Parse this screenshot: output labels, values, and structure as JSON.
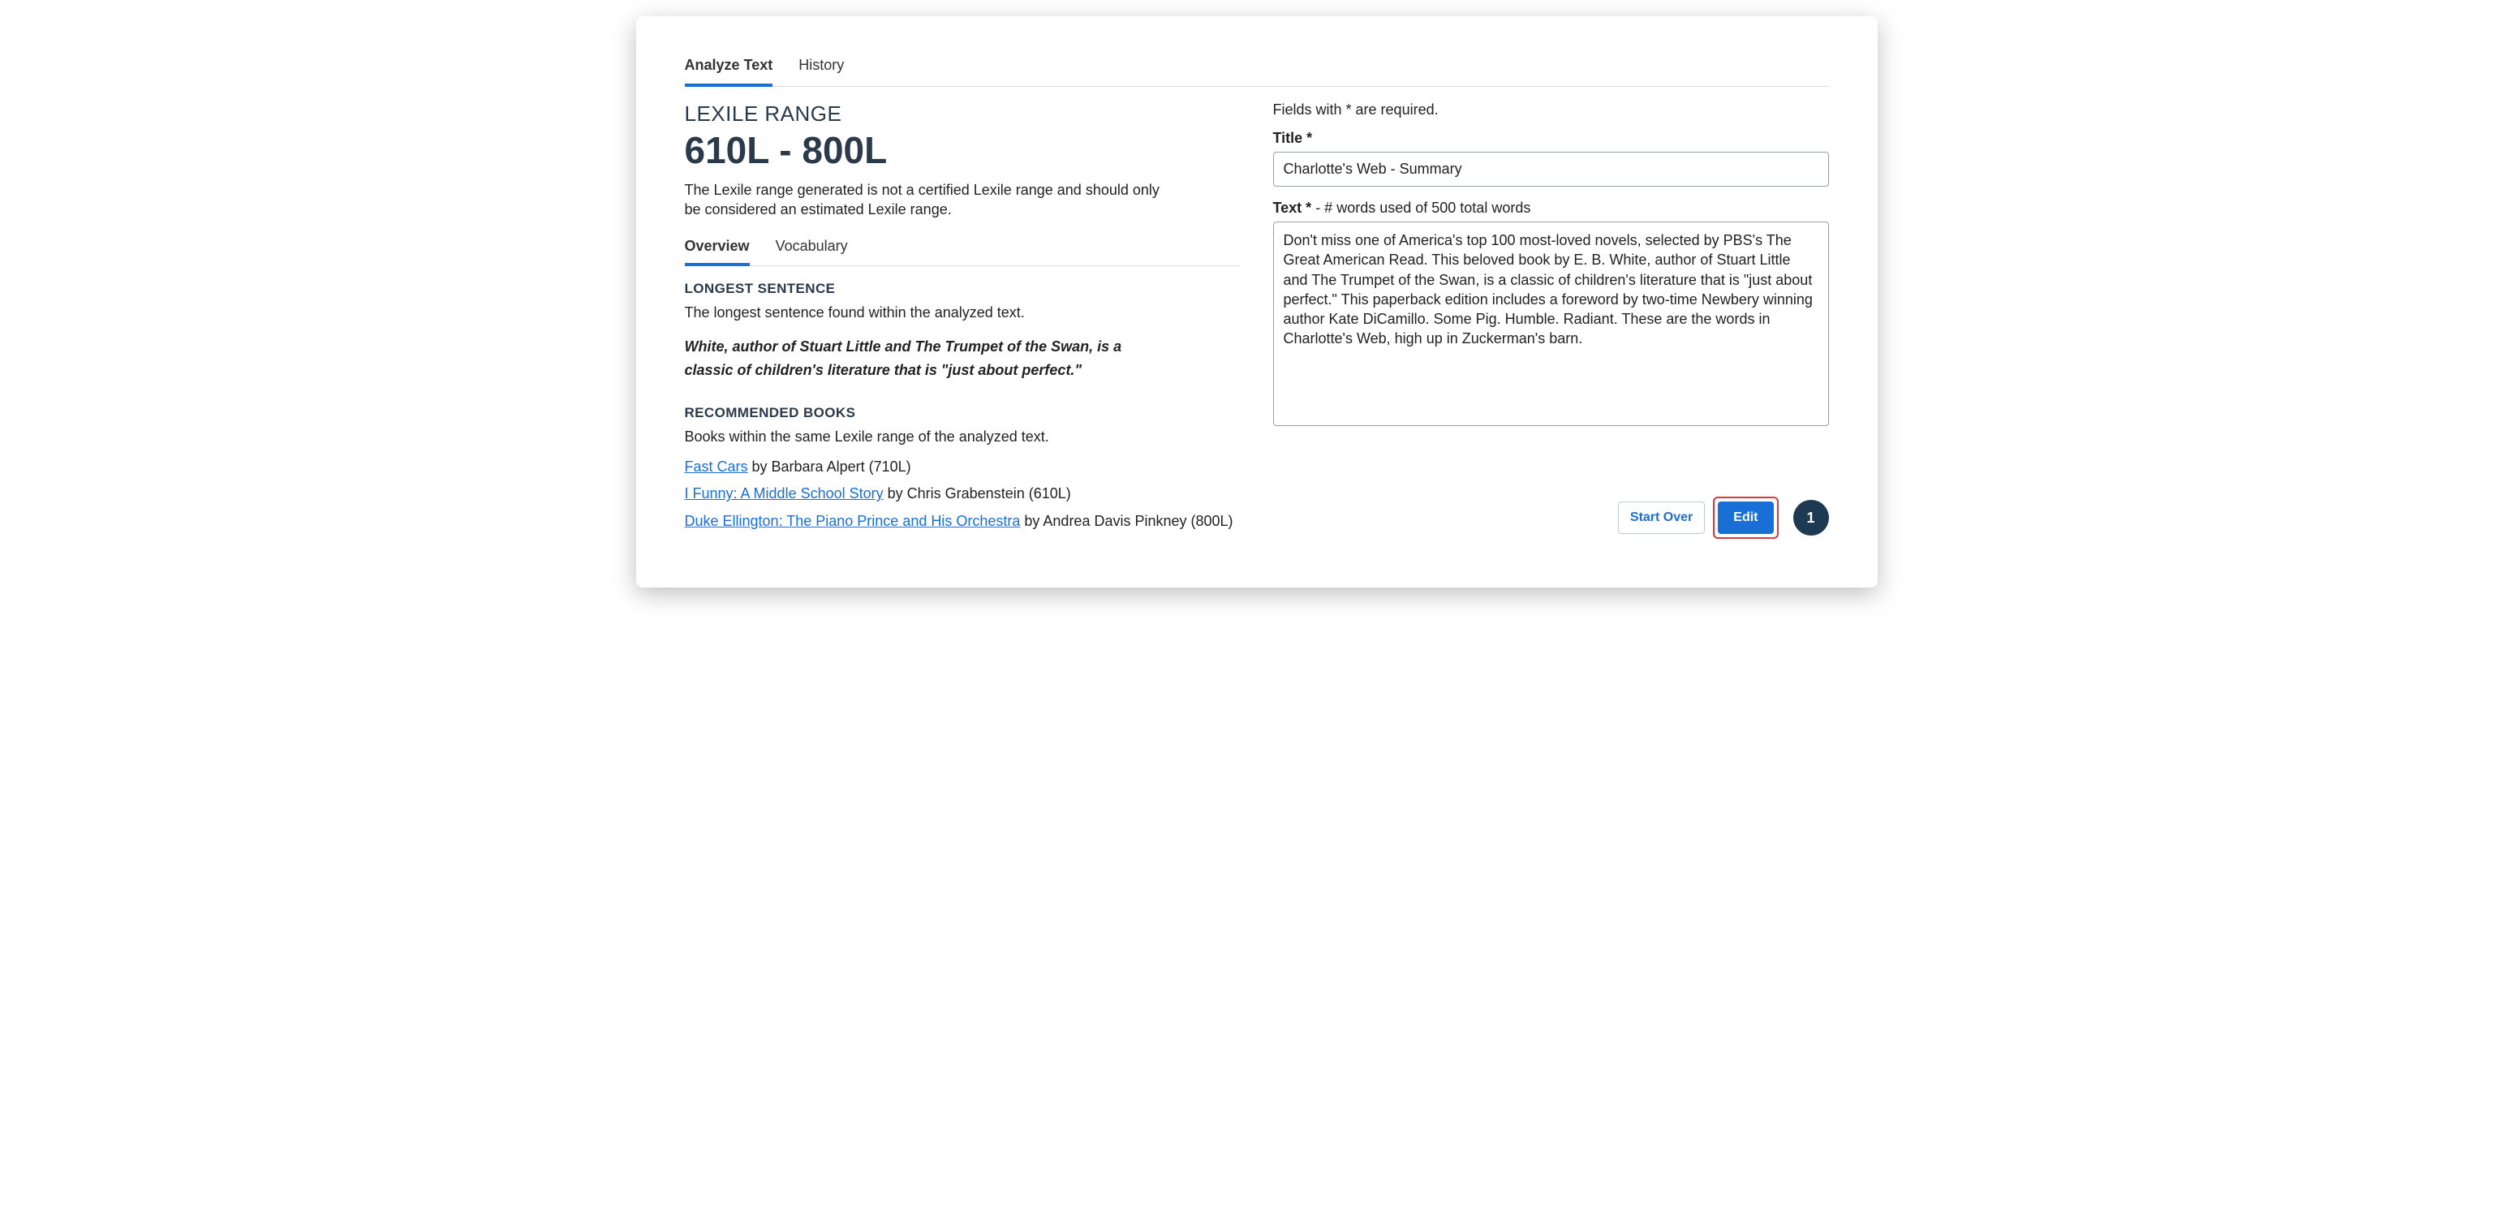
{
  "top_tabs": {
    "analyze": "Analyze Text",
    "history": "History"
  },
  "lexile": {
    "label": "LEXILE RANGE",
    "value": "610L - 800L",
    "note": "The Lexile range generated is not a certified Lexile range and should only be considered an estimated Lexile range."
  },
  "inner_tabs": {
    "overview": "Overview",
    "vocabulary": "Vocabulary"
  },
  "longest": {
    "heading": "LONGEST SENTENCE",
    "sub": "The longest sentence found within the analyzed  text.",
    "sentence": "White, author of Stuart Little and The Trumpet of the Swan, is a classic of children's literature that is \"just about perfect.\""
  },
  "recommended": {
    "heading": "RECOMMENDED BOOKS",
    "sub": "Books within the same Lexile range of the analyzed text.",
    "books": [
      {
        "title": "Fast Cars",
        "byline": " by Barbara Alpert (710L)"
      },
      {
        "title": "I Funny: A Middle School Story",
        "byline": " by Chris Grabenstein (610L)"
      },
      {
        "title": "Duke Ellington: The Piano Prince and His Orchestra",
        "byline": " by Andrea Davis Pinkney (800L)"
      }
    ]
  },
  "form": {
    "required_note": "Fields with * are required.",
    "title_label": "Title *",
    "title_value": "Charlotte's Web - Summary",
    "text_label_prefix": "Text *",
    "text_label_suffix": " -  # words used of 500 total words",
    "text_value": "Don't miss one of America's top 100 most-loved novels, selected by PBS's The Great American Read. This beloved book by E. B. White, author of Stuart Little and The Trumpet of the Swan, is a classic of children's literature that is \"just about perfect.\" This paperback edition includes a foreword by two-time Newbery winning author Kate DiCamillo. Some Pig. Humble. Radiant. These are the words in Charlotte's Web, high up in Zuckerman's barn."
  },
  "actions": {
    "start_over": "Start Over",
    "edit": "Edit",
    "step_badge": "1"
  }
}
